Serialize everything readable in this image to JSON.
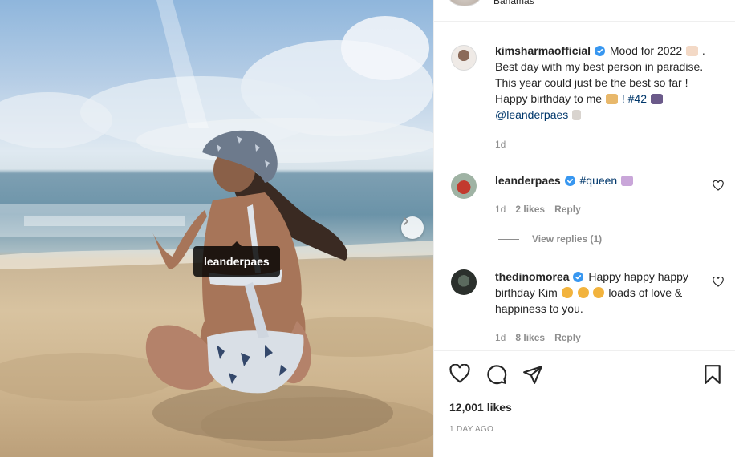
{
  "post": {
    "header_location": "Bahamas",
    "author": "kimsharmaofficial",
    "caption_part1": "Mood for 2022",
    "caption_part2": ". Best day with my best person in paradise. This year could just be the best so far ! Happy birthday to me",
    "caption_part3": "! #42",
    "mention": "@leanderpaes",
    "time": "1d",
    "tag_label": "leanderpaes",
    "likes": "12,001 likes",
    "posted_ago": "1 DAY AGO"
  },
  "comments": [
    {
      "user": "leanderpaes",
      "text": "#queen",
      "time": "1d",
      "likes": "2 likes",
      "reply_label": "Reply",
      "view_replies": "View replies (1)"
    },
    {
      "user": "thedinomorea",
      "text_part1": "Happy happy happy birthday Kim",
      "text_part2": "loads of love & happiness to you.",
      "time": "1d",
      "likes": "8 likes",
      "reply_label": "Reply"
    }
  ],
  "icons": {
    "verified": "verified-badge-icon",
    "like": "heart-icon",
    "comment": "comment-icon",
    "share": "paper-plane-icon",
    "save": "bookmark-icon",
    "carousel": "chevron-right-icon"
  },
  "colors": {
    "verified": "#3897f0",
    "link": "#00376b",
    "muted": "#8e8e8e",
    "text": "#262626"
  }
}
